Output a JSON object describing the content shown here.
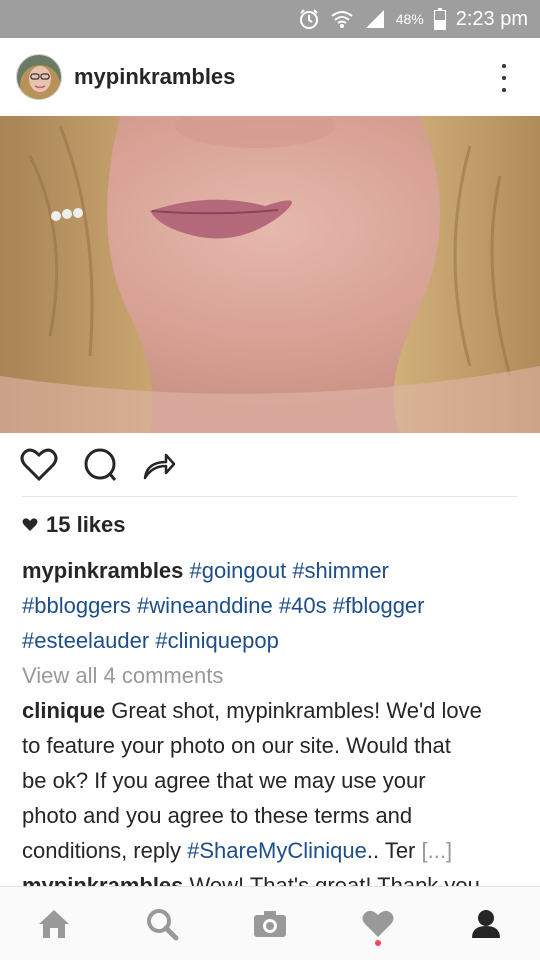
{
  "status_bar": {
    "battery_percent": "48%",
    "time": "2:23 pm",
    "icons": [
      "alarm-icon",
      "wifi-icon",
      "signal-icon",
      "battery-icon"
    ]
  },
  "post": {
    "username": "mypinkrambles",
    "likes": "15 likes",
    "caption": {
      "username": "mypinkrambles",
      "hashtags_line1": [
        "#goingout",
        "#shimmer"
      ],
      "hashtags_line2": [
        "#bbloggers",
        "#wineanddine",
        "#40s",
        "#fblogger"
      ],
      "hashtags_line3": [
        "#esteelauder",
        "#cliniquepop"
      ]
    },
    "view_comments": "View all 4 comments",
    "comment": {
      "username": "clinique",
      "text_line1": "Great shot, mypinkrambles! We'd love",
      "text_line2": "to feature your photo on our site. Would that",
      "text_line3": "be ok? If you agree that we may use your",
      "text_line4": "photo and you agree to these terms and",
      "text_line5_start": "conditions, reply",
      "text_line5_tag": "#ShareMyClinique",
      "text_line5_end": ".. Ter",
      "more": "[...]"
    },
    "reply": {
      "username": "mypinkrambles",
      "text": "Wow! That's great! Thank you"
    }
  },
  "nav": {
    "items": [
      "home-icon",
      "search-icon",
      "camera-icon",
      "activity-heart-icon",
      "profile-icon"
    ],
    "colors": {
      "active": "#262626",
      "inactive": "#999999",
      "notification": "#ed4956"
    }
  },
  "colors": {
    "status_bar": "#9e9e9e",
    "hashtag": "#1d4e8a",
    "muted_text": "#999999"
  }
}
